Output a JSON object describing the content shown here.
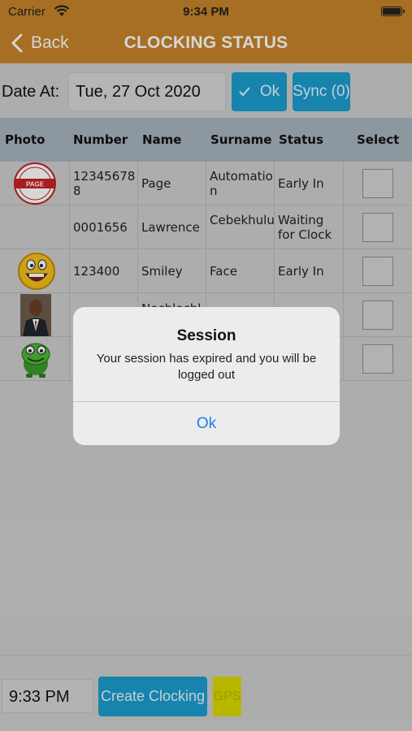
{
  "status_bar": {
    "carrier": "Carrier",
    "time": "9:34 PM"
  },
  "nav": {
    "back_label": "Back",
    "title": "CLOCKING STATUS"
  },
  "date_row": {
    "label": "Date At:",
    "value": "Tue, 27 Oct 2020",
    "ok_label": "Ok",
    "sync_label": "Sync (0)"
  },
  "table": {
    "headers": [
      "Photo",
      "Number",
      "Name",
      "Surname",
      "Status",
      "Select"
    ],
    "rows": [
      {
        "photo": "page-logo",
        "number": "123456788",
        "name": "Page",
        "surname": "Automation",
        "status": "Early In"
      },
      {
        "photo": "",
        "number": "0001656",
        "name": "Lawrence",
        "surname": "Cebekhulu",
        "status": "Waiting for Clock"
      },
      {
        "photo": "smiley-face",
        "number": "123400",
        "name": "Smiley",
        "surname": "Face",
        "status": "Early In"
      },
      {
        "photo": "man-in-suit",
        "number": "",
        "name": "Nochlochl",
        "surname": "",
        "status": ""
      },
      {
        "photo": "green-monster",
        "number": "",
        "name": "",
        "surname": "",
        "status": ""
      }
    ]
  },
  "bottom": {
    "time_value": "9:33 PM",
    "create_label": "Create Clocking",
    "gps_label": "GPS"
  },
  "alert": {
    "title": "Session",
    "message": "Your session has expired and you will be logged out",
    "ok_label": "Ok"
  },
  "colors": {
    "header_bg": "#c8852a",
    "accent": "#1b9ecf",
    "gps": "#dbdb00",
    "alert_link": "#1a7fe8"
  }
}
